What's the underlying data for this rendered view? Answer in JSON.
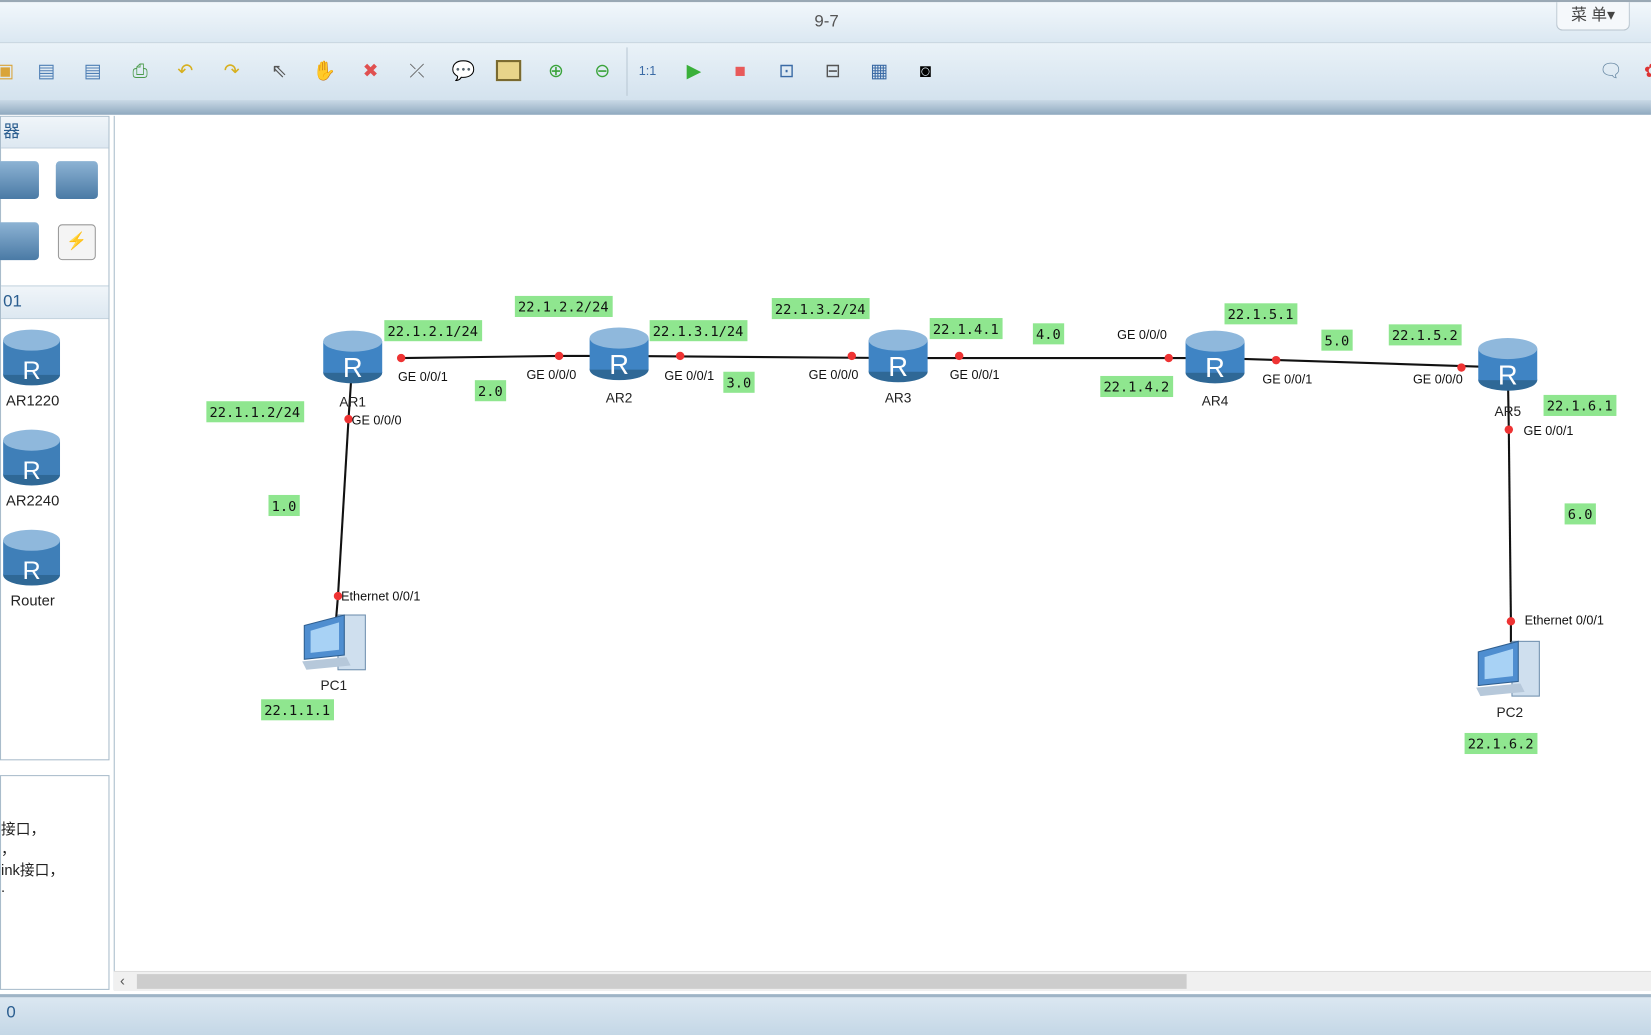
{
  "window": {
    "title": "9-7",
    "menu_label": "菜 单▾"
  },
  "toolbar": {
    "icons": [
      "open-icon",
      "save-icon",
      "save-as-icon",
      "print-icon",
      "undo-icon",
      "redo-icon",
      "select-icon",
      "pan-hand-icon",
      "delete-icon",
      "delete-link-icon",
      "text-comment-icon",
      "rectangle-icon",
      "zoom-in-icon",
      "zoom-out-icon",
      "fit-icon",
      "start-icon",
      "stop-icon",
      "capture-icon",
      "topology-icon",
      "grid-icon",
      "cli-icon"
    ],
    "right_icons": [
      "chat-icon",
      "huawei-icon"
    ]
  },
  "left_panel": {
    "category_header": "器",
    "section_header": "01",
    "devices": [
      {
        "label": "AR1220"
      },
      {
        "label": "AR2240"
      },
      {
        "label": "Router"
      }
    ],
    "description_lines": [
      "接口，",
      "，",
      "ink接口，",
      "."
    ]
  },
  "status_bar": {
    "text": "0"
  },
  "colors": {
    "label_bg": "#8fe68f",
    "link_dot": "#ee3333",
    "router": "#3f84c4"
  },
  "topology": {
    "devices": {
      "ar1": "AR1",
      "ar2": "AR2",
      "ar3": "AR3",
      "ar4": "AR4",
      "ar5": "AR5",
      "pc1": "PC1",
      "pc2": "PC2"
    },
    "ports": {
      "ar1_g1": "GE 0/0/1",
      "ar1_g0": "GE 0/0/0",
      "ar2_g0": "GE 0/0/0",
      "ar2_g1": "GE 0/0/1",
      "ar3_g0": "GE 0/0/0",
      "ar3_g1": "GE 0/0/1",
      "ar4_g0": "GE 0/0/0",
      "ar4_g1": "GE 0/0/1",
      "ar5_g0": "GE 0/0/0",
      "ar5_g1": "GE 0/0/1",
      "pc1_e": "Ethernet 0/0/1",
      "pc2_e": "Ethernet 0/0/1"
    },
    "labels": {
      "l1": "22.1.2.1/24",
      "l2": "22.1.2.2/24",
      "l3": "22.1.3.1/24",
      "l4": "22.1.3.2/24",
      "l5": "22.1.4.1",
      "l6": "4.0",
      "l7": "22.1.5.1",
      "l8": "5.0",
      "l9": "22.1.5.2",
      "l10": "22.1.4.2",
      "l11": "22.1.6.1",
      "l12": "22.1.1.2/24",
      "l13": "2.0",
      "l14": "3.0",
      "l15": "1.0",
      "l16": "6.0",
      "l17": "22.1.1.1",
      "l18": "22.1.6.2"
    }
  }
}
